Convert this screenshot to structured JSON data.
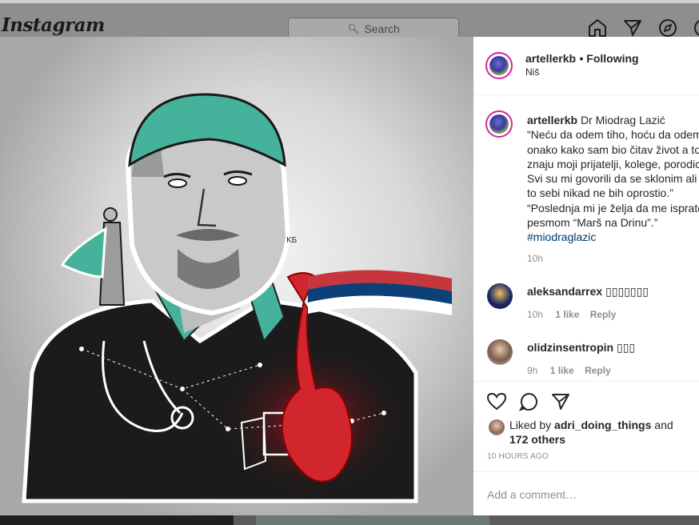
{
  "app": {
    "logo": "Instagram"
  },
  "search": {
    "placeholder": "Search"
  },
  "nav": {
    "icons": [
      "home-icon",
      "direct-icon",
      "explore-icon"
    ]
  },
  "post": {
    "author": "artellerkb",
    "follow_state": "• Following",
    "location": "Niš",
    "caption_title": "Dr Miodrag Lazić",
    "caption_lines": [
      "“Neću da odem tiho, hoću da odem",
      "onako kako sam bio čitav život a to",
      "znaju moji prijatelji, kolege, porodic",
      "Svi su mi govorili da se sklonim ali",
      "to sebi nikad ne bih oprostio.”",
      "“Poslednja mi je želja da me ispratc",
      "pesmom “Marš na Drinu”.”"
    ],
    "hashtag": "#miodraglazic",
    "caption_time": "10h",
    "artwork_signature": "KБ"
  },
  "comments": [
    {
      "user": "aleksandarrex",
      "text": "▯▯▯▯▯▯▯",
      "time": "10h",
      "likes": "1 like",
      "reply": "Reply"
    },
    {
      "user": "olidzinsentropin",
      "text": "▯▯▯",
      "time": "9h",
      "likes": "1 like",
      "reply": "Reply"
    }
  ],
  "likes": {
    "prefix": "Liked by",
    "user": "adri_doing_things",
    "and": "and",
    "others": "172 others"
  },
  "timestamp": "10 HOURS AGO",
  "comment_box": {
    "placeholder": "Add a comment…"
  },
  "colors": {
    "accent_link": "#00376b",
    "flag_red": "#c6363c",
    "flag_blue": "#0c4076",
    "scrub_teal": "#45b39c"
  }
}
